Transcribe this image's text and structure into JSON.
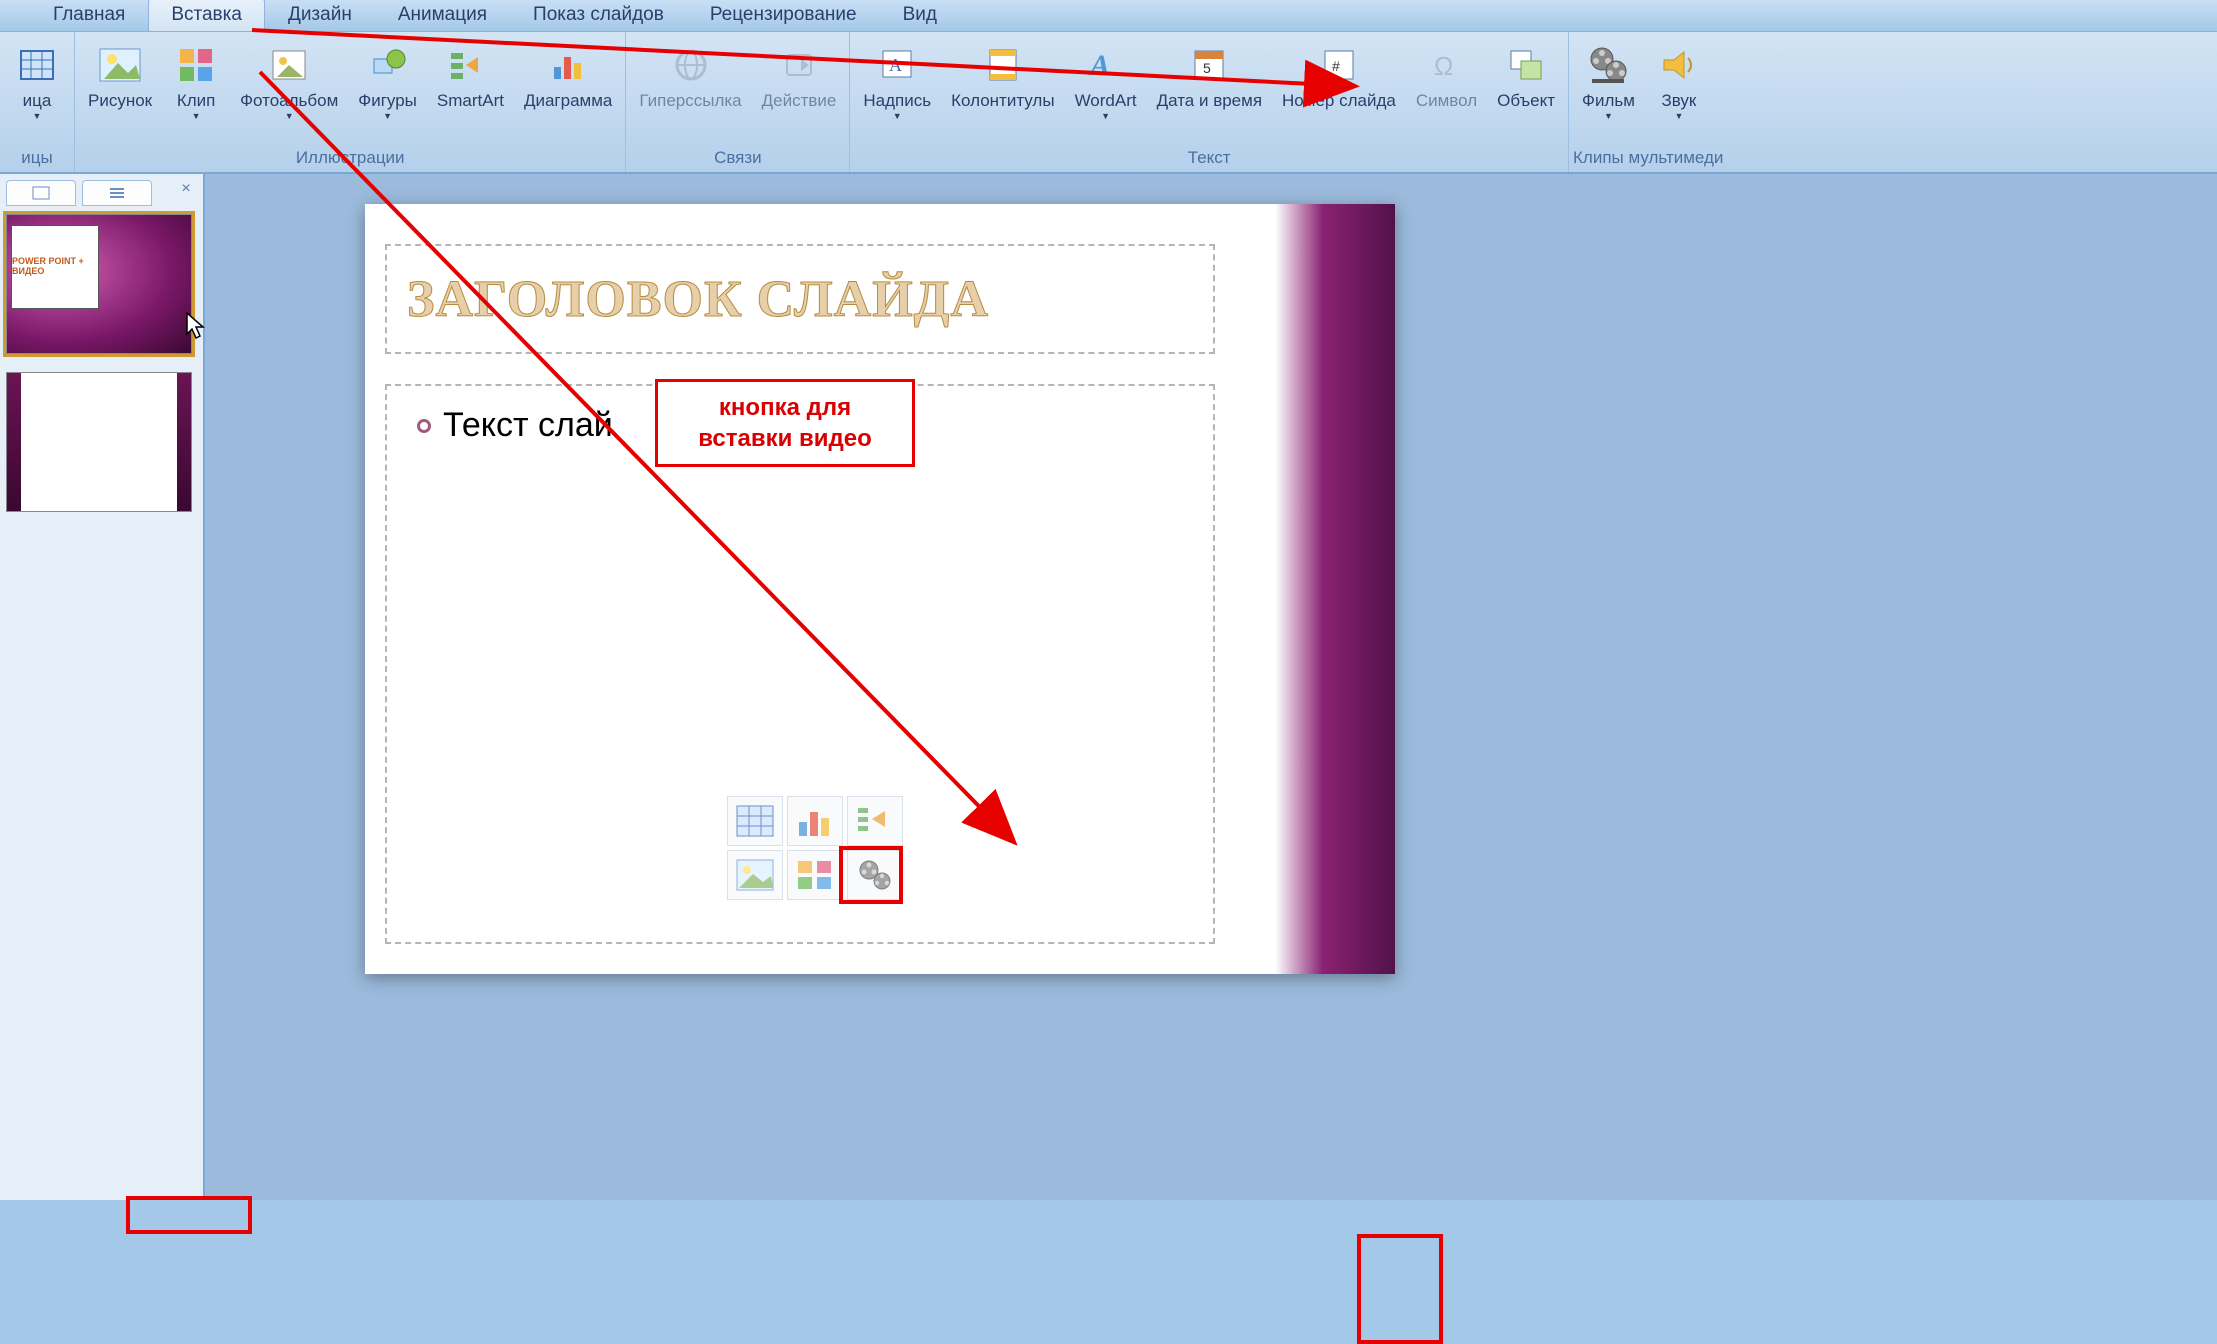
{
  "tabs": {
    "home": "Главная",
    "insert": "Вставка",
    "design": "Дизайн",
    "animation": "Анимация",
    "slideshow": "Показ слайдов",
    "review": "Рецензирование",
    "view": "Вид"
  },
  "ribbon": {
    "tables_group": {
      "table": "ица",
      "label": "ицы"
    },
    "illustrations": {
      "picture": "Рисунок",
      "clip": "Клип",
      "photoalbum": "Фотоальбом",
      "shapes": "Фигуры",
      "smartart": "SmartArt",
      "chart": "Диаграмма",
      "label": "Иллюстрации"
    },
    "links": {
      "hyperlink": "Гиперссылка",
      "action": "Действие",
      "label": "Связи"
    },
    "text": {
      "textbox": "Надпись",
      "headerfooter": "Колонтитулы",
      "wordart": "WordArt",
      "datetime": "Дата и время",
      "slidenum": "Номер слайда",
      "symbol": "Символ",
      "object": "Объект",
      "label": "Текст"
    },
    "media": {
      "movie": "Фильм",
      "sound": "Звук",
      "label": "Клипы мультимеди"
    }
  },
  "slide": {
    "title": "ЗАГОЛОВОК СЛАЙДА",
    "body": "Текст слай"
  },
  "thumb1_label": "POWER POINT + ВИДЕО",
  "callout": {
    "line1": "кнопка для",
    "line2": "вставки видео"
  }
}
